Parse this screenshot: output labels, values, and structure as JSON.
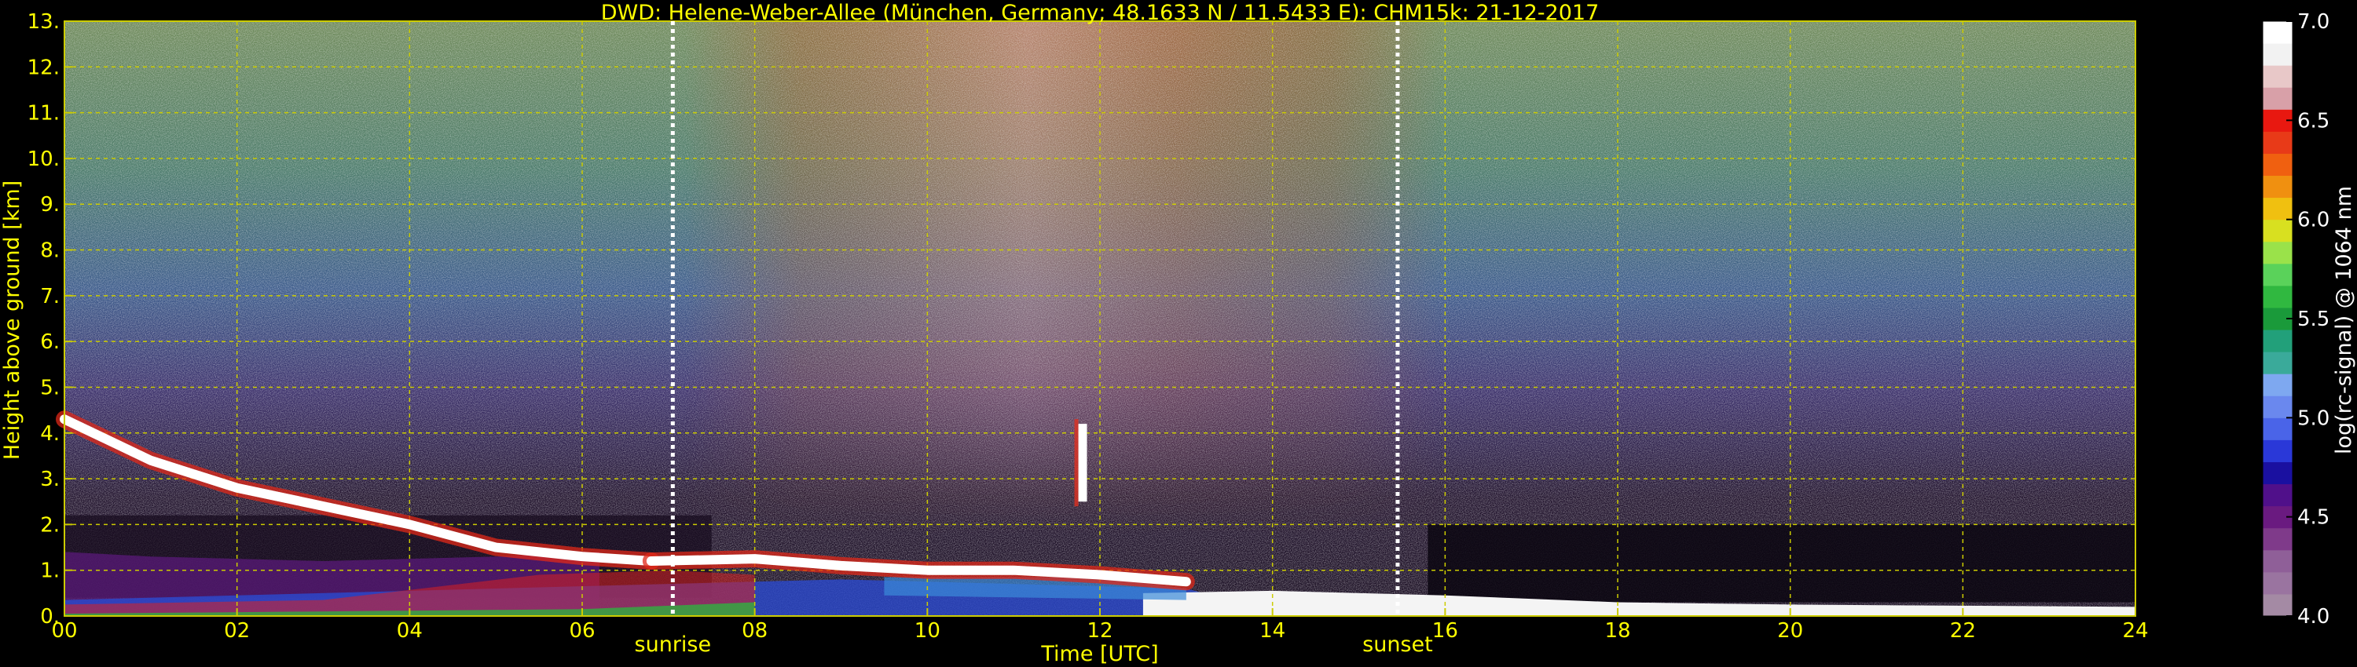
{
  "chart_data": {
    "type": "heatmap",
    "title": "DWD: Helene-Weber-Allee (München, Germany; 48.1633 N / 11.5433 E):    CHM15k: 21-12-2017",
    "xlabel": "Time [UTC]",
    "ylabel": "Height above ground [km]",
    "xlim": [
      0,
      24
    ],
    "ylim": [
      0,
      13
    ],
    "x_ticks": [
      "00",
      "02",
      "04",
      "06",
      "08",
      "10",
      "12",
      "14",
      "16",
      "18",
      "20",
      "22",
      "24"
    ],
    "y_ticks": [
      "0.",
      "1.",
      "2.",
      "3.",
      "4.",
      "5.",
      "6.",
      "7.",
      "8.",
      "9.",
      "10.",
      "11.",
      "12.",
      "13."
    ],
    "grid": true,
    "markers": [
      {
        "label": "sunrise",
        "x": 7.05
      },
      {
        "label": "sunset",
        "x": 15.45
      }
    ],
    "colorbar": {
      "label": "log(rc-signal) @ 1064 nm",
      "range": [
        4.0,
        7.0
      ],
      "ticks": [
        "4.0",
        "4.5",
        "5.0",
        "5.5",
        "6.0",
        "6.5",
        "7.0"
      ]
    },
    "features": [
      {
        "name": "descending cloud layer",
        "t": [
          0.0,
          1.0,
          2.0,
          3.0,
          4.0,
          5.0,
          6.0,
          6.8
        ],
        "h": [
          4.3,
          3.4,
          2.8,
          2.4,
          2.0,
          1.5,
          1.3,
          1.2
        ]
      },
      {
        "name": "boundary layer top",
        "t": [
          6.8,
          8.0,
          9.0,
          10.0,
          11.0,
          12.0,
          13.0
        ],
        "h": [
          1.2,
          1.25,
          1.1,
          1.0,
          1.0,
          0.9,
          0.75
        ]
      },
      {
        "name": "isolated cloud",
        "t": [
          11.75,
          11.85
        ],
        "h": [
          2.5,
          4.2
        ]
      }
    ],
    "colors": {
      "background": "#000000",
      "text": "#ffff00",
      "grid": "#cccc00",
      "colorbar_label": "#ffffff"
    }
  }
}
